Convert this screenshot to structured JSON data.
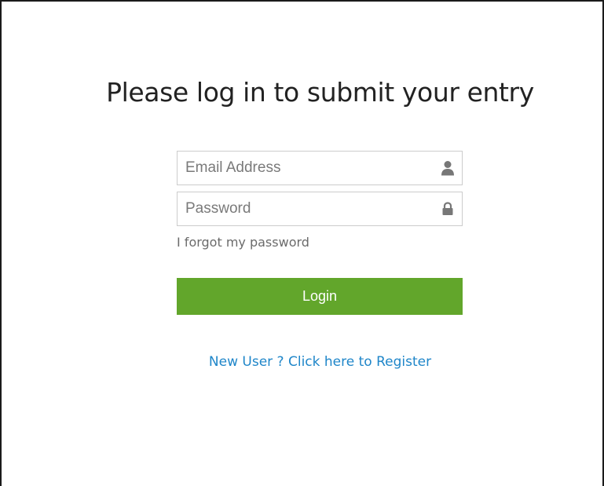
{
  "heading": "Please log in to submit your entry",
  "email_field": {
    "placeholder": "Email Address",
    "value": "",
    "icon": "user-icon"
  },
  "password_field": {
    "placeholder": "Password",
    "value": "",
    "icon": "lock-icon"
  },
  "forgot_password_label": "I forgot my password",
  "login_button_label": "Login",
  "register_link_label": "New User ? Click here to Register",
  "colors": {
    "login_button": "#62a62b",
    "register_link": "#1f86c9",
    "forgot_link": "#6b6b6b",
    "icon": "#777777"
  }
}
